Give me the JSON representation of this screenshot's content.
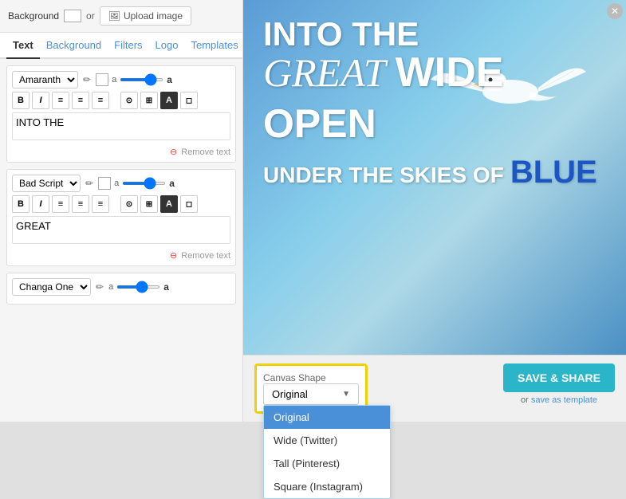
{
  "header": {
    "background_label": "Background",
    "or_label": "or",
    "upload_btn_label": "Upload image"
  },
  "tabs": [
    {
      "id": "text",
      "label": "Text",
      "active": true,
      "color": "default"
    },
    {
      "id": "background",
      "label": "Background",
      "active": false,
      "color": "blue"
    },
    {
      "id": "filters",
      "label": "Filters",
      "active": false,
      "color": "blue"
    },
    {
      "id": "logo",
      "label": "Logo",
      "active": false,
      "color": "blue"
    },
    {
      "id": "templates",
      "label": "Templates",
      "active": false,
      "color": "blue"
    }
  ],
  "text_blocks": [
    {
      "id": "block1",
      "font": "Amaranth",
      "alpha_label": "a",
      "a_label": "a",
      "content": "INTO THE",
      "remove_label": "Remove text"
    },
    {
      "id": "block2",
      "font": "Bad Script",
      "alpha_label": "a",
      "a_label": "a",
      "content": "GREAT",
      "remove_label": "Remove text"
    },
    {
      "id": "block3",
      "font": "Changa One",
      "alpha_label": "a",
      "a_label": "a",
      "content": ""
    }
  ],
  "canvas": {
    "line1": "INTO THE",
    "line2_italic": "GREAT",
    "line2_bold": "WIDE",
    "line3": "OPEN",
    "line4_white": "UNDER THE SKIES OF",
    "line4_blue": "BLUE"
  },
  "canvas_shape": {
    "label": "Canvas Shape",
    "current_value": "Original",
    "options": [
      {
        "id": "original",
        "label": "Original",
        "selected": true
      },
      {
        "id": "wide",
        "label": "Wide (Twitter)",
        "selected": false
      },
      {
        "id": "tall",
        "label": "Tall (Pinterest)",
        "selected": false
      },
      {
        "id": "square",
        "label": "Square (Instagram)",
        "selected": false
      }
    ]
  },
  "save": {
    "btn_label": "SAVE & SHARE",
    "or_label": "or",
    "template_link_label": "save as template"
  }
}
